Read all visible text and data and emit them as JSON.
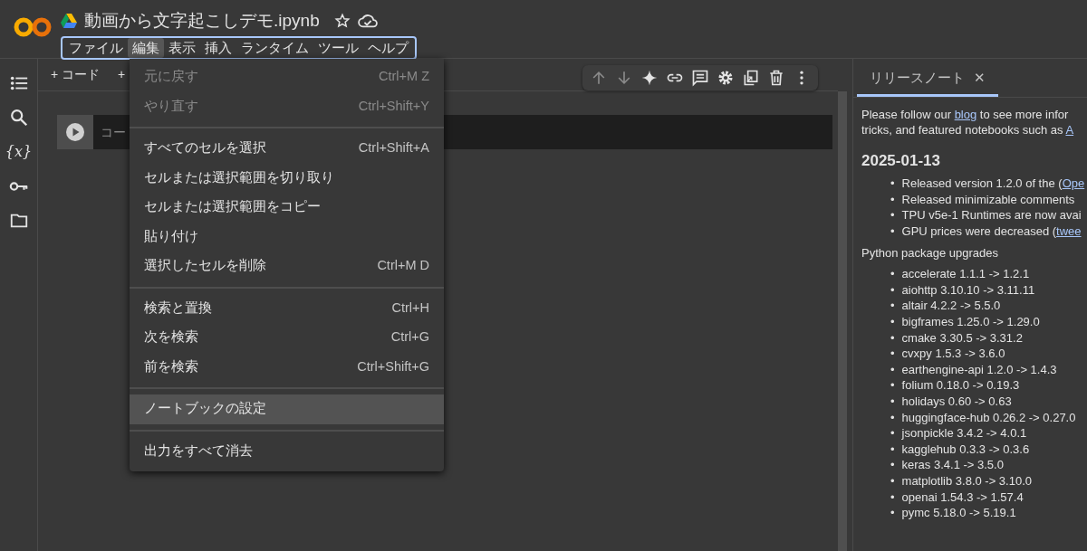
{
  "header": {
    "title": "動画から文字起こしデモ.ipynb"
  },
  "menubar": [
    {
      "label": "ファイル",
      "selected": false
    },
    {
      "label": "編集",
      "selected": true
    },
    {
      "label": "表示",
      "selected": false
    },
    {
      "label": "挿入",
      "selected": false
    },
    {
      "label": "ランタイム",
      "selected": false
    },
    {
      "label": "ツール",
      "selected": false
    },
    {
      "label": "ヘルプ",
      "selected": false
    }
  ],
  "sidebar": {
    "variables_glyph": "{x}"
  },
  "toolbar": [
    "+ コード",
    "+"
  ],
  "cell": {
    "placeholder": "コー"
  },
  "edit_menu": [
    {
      "kind": "item",
      "label": "元に戻す",
      "shortcut": "Ctrl+M Z",
      "disabled": true,
      "selected": false
    },
    {
      "kind": "item",
      "label": "やり直す",
      "shortcut": "Ctrl+Shift+Y",
      "disabled": true,
      "selected": false
    },
    {
      "kind": "divider"
    },
    {
      "kind": "item",
      "label": "すべてのセルを選択",
      "shortcut": "Ctrl+Shift+A",
      "disabled": false,
      "selected": false
    },
    {
      "kind": "item",
      "label": "セルまたは選択範囲を切り取り",
      "disabled": false,
      "selected": false
    },
    {
      "kind": "item",
      "label": "セルまたは選択範囲をコピー",
      "disabled": false,
      "selected": false
    },
    {
      "kind": "item",
      "label": "貼り付け",
      "disabled": false,
      "selected": false
    },
    {
      "kind": "item",
      "label": "選択したセルを削除",
      "shortcut": "Ctrl+M D",
      "disabled": false,
      "selected": false
    },
    {
      "kind": "divider"
    },
    {
      "kind": "item",
      "label": "検索と置換",
      "shortcut": "Ctrl+H",
      "disabled": false,
      "selected": false
    },
    {
      "kind": "item",
      "label": "次を検索",
      "shortcut": "Ctrl+G",
      "disabled": false,
      "selected": false
    },
    {
      "kind": "item",
      "label": "前を検索",
      "shortcut": "Ctrl+Shift+G",
      "disabled": false,
      "selected": false
    },
    {
      "kind": "divider"
    },
    {
      "kind": "item",
      "label": "ノートブックの設定",
      "disabled": false,
      "selected": true
    },
    {
      "kind": "divider"
    },
    {
      "kind": "item",
      "label": "出力をすべて消去",
      "disabled": false,
      "selected": false
    }
  ],
  "side_panel": {
    "tab": {
      "label": "リリースノート",
      "close": "✕",
      "selected": true
    },
    "intro": [
      [
        {
          "text": "Please follow our "
        },
        {
          "text": "blog",
          "link": true
        },
        {
          "text": " to see more infor"
        }
      ],
      [
        {
          "text": "tricks, and featured notebooks such as "
        },
        {
          "text": "A",
          "link": true
        }
      ]
    ],
    "heading": "2025-01-13",
    "bullet": "•",
    "notes": [
      [
        {
          "text": "Released version 1.2.0 of the ("
        },
        {
          "text": "Ope",
          "link": true
        }
      ],
      [
        {
          "text": "Released minimizable comments"
        }
      ],
      [
        {
          "text": "TPU v5e-1 Runtimes are now avai"
        }
      ],
      [
        {
          "text": "GPU prices were decreased ("
        },
        {
          "text": "twee",
          "link": true
        }
      ]
    ],
    "subheading": "Python package upgrades",
    "packages": [
      "accelerate 1.1.1 -> 1.2.1",
      "aiohttp 3.10.10 -> 3.11.11",
      "altair 4.2.2 -> 5.5.0",
      "bigframes 1.25.0 -> 1.29.0",
      "cmake 3.30.5 -> 3.31.2",
      "cvxpy 1.5.3 -> 3.6.0",
      "earthengine-api 1.2.0 -> 1.4.3",
      "folium 0.18.0 -> 0.19.3",
      "holidays 0.60 -> 0.63",
      "huggingface-hub 0.26.2 -> 0.27.0",
      "jsonpickle 3.4.2 -> 4.0.1",
      "kagglehub 0.3.3 -> 0.3.6",
      "keras 3.4.1 -> 3.5.0",
      "matplotlib 3.8.0 -> 3.10.0",
      "openai 1.54.3 -> 1.57.4",
      "pymc 5.18.0 -> 5.19.1"
    ]
  }
}
